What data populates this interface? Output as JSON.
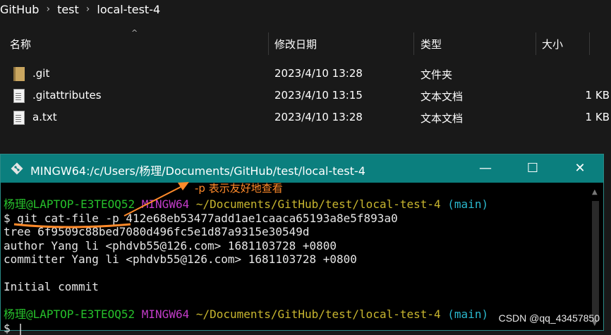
{
  "breadcrumb": [
    "GitHub",
    "test",
    "local-test-4"
  ],
  "columns": {
    "name": "名称",
    "modified": "修改日期",
    "type": "类型",
    "size": "大小"
  },
  "files": [
    {
      "icon": "folder-icon",
      "name": ".git",
      "modified": "2023/4/10 13:28",
      "type": "文件夹",
      "size": ""
    },
    {
      "icon": "document-icon",
      "name": ".gitattributes",
      "modified": "2023/4/10 13:15",
      "type": "文本文档",
      "size": "1 KB"
    },
    {
      "icon": "document-icon",
      "name": "a.txt",
      "modified": "2023/4/10 13:28",
      "type": "文本文档",
      "size": "1 KB"
    }
  ],
  "terminal": {
    "title": "MINGW64:/c/Users/杨理/Documents/GitHub/test/local-test-4",
    "minimize": "—",
    "maximize": "☐",
    "close": "✕",
    "prompt": {
      "user": "杨理@LAPTOP-E3TEOQ52",
      "host": "MINGW64",
      "path": "~/Documents/GitHub/test/local-test-4",
      "branch": "(main)"
    },
    "lines": [
      "$ git cat-file -p 412e68eb53477add1ae1caaca65193a8e5f893a0",
      "tree 6f9509c88bed7080d496fc5e1d87a9315e30549d",
      "author Yang li <phdvb55@126.com> 1681103728 +0800",
      "committer Yang li <phdvb55@126.com> 1681103728 +0800",
      "",
      "Initial commit",
      ""
    ],
    "final_prompt": "$ |"
  },
  "annotation": "-p 表示友好地查看",
  "watermark": "CSDN @qq_43457850",
  "colors": {
    "titlebar": "#0b7f7e",
    "annotation": "#ff8a2a",
    "prompt_user": "#26c02b",
    "prompt_host": "#c23cc8",
    "prompt_path": "#c8b62f",
    "prompt_branch": "#2ab7cc"
  }
}
